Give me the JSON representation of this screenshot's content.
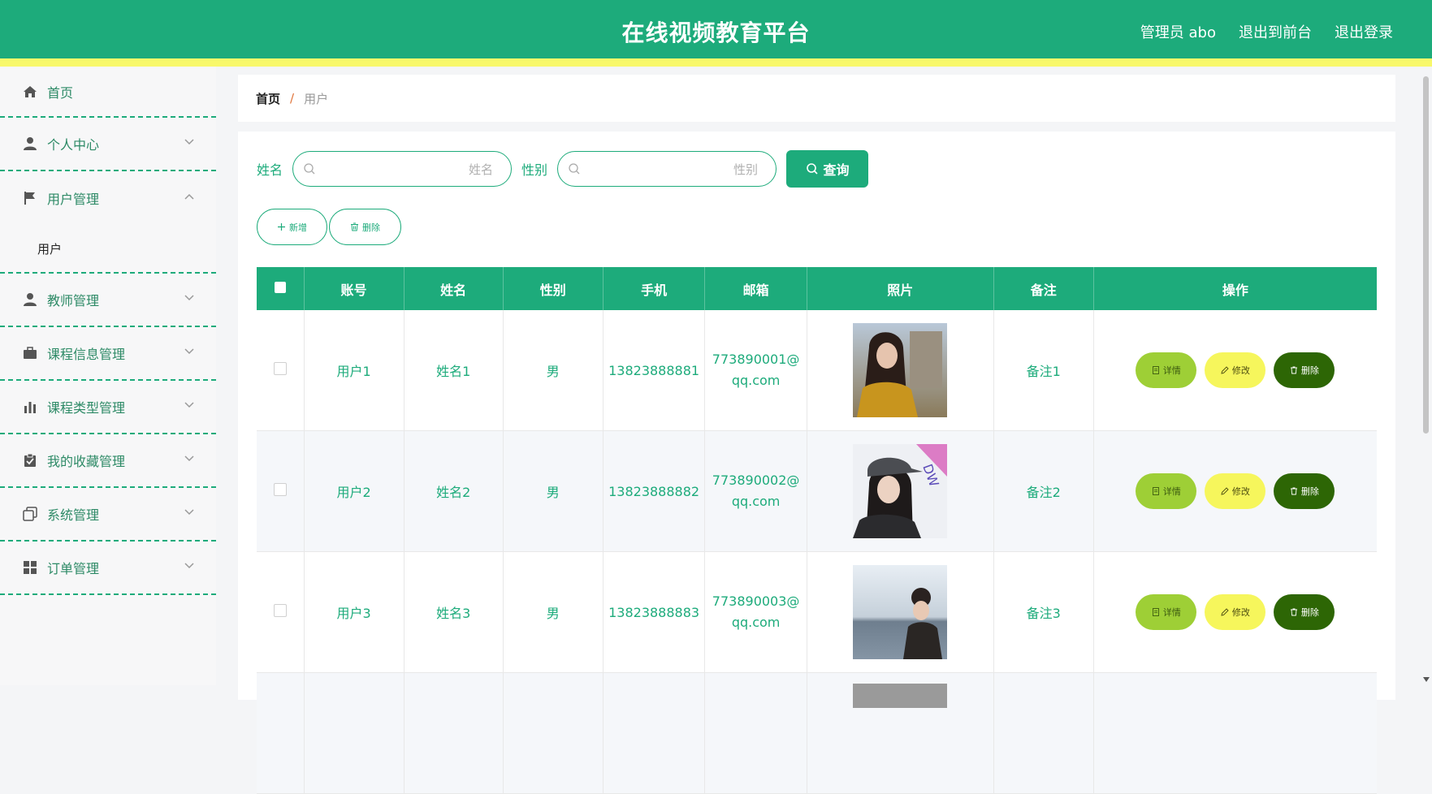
{
  "header": {
    "title": "在线视频教育平台",
    "admin_label": "管理员 abo",
    "front_label": "退出到前台",
    "logout_label": "退出登录"
  },
  "sidebar": {
    "items": [
      {
        "label": "首页",
        "icon": "home-icon"
      },
      {
        "label": "个人中心",
        "icon": "user-icon"
      },
      {
        "label": "用户管理",
        "icon": "flag-icon",
        "submenu": [
          "用户"
        ]
      },
      {
        "label": "教师管理",
        "icon": "user-icon"
      },
      {
        "label": "课程信息管理",
        "icon": "briefcase-icon"
      },
      {
        "label": "课程类型管理",
        "icon": "bar-chart-icon"
      },
      {
        "label": "我的收藏管理",
        "icon": "clipboard-icon"
      },
      {
        "label": "系统管理",
        "icon": "copy-icon"
      },
      {
        "label": "订单管理",
        "icon": "grid-icon"
      }
    ]
  },
  "breadcrumb": {
    "home": "首页",
    "separator": "/",
    "current": "用户"
  },
  "search": {
    "name_label": "姓名",
    "name_placeholder": "姓名",
    "gender_label": "性别",
    "gender_placeholder": "性别",
    "query_label": "查询"
  },
  "actions": {
    "add_label": "新增",
    "delete_label": "删除"
  },
  "table": {
    "headers": [
      "账号",
      "姓名",
      "性别",
      "手机",
      "邮箱",
      "照片",
      "备注",
      "操作"
    ],
    "rows": [
      {
        "account": "用户1",
        "name": "姓名1",
        "gender": "男",
        "phone": "13823888881",
        "email_a": "773890001@",
        "email_b": "qq.com",
        "note": "备注1"
      },
      {
        "account": "用户2",
        "name": "姓名2",
        "gender": "男",
        "phone": "13823888882",
        "email_a": "773890002@",
        "email_b": "qq.com",
        "note": "备注2"
      },
      {
        "account": "用户3",
        "name": "姓名3",
        "gender": "男",
        "phone": "13823888883",
        "email_a": "773890003@",
        "email_b": "qq.com",
        "note": "备注3"
      }
    ],
    "ops": {
      "detail": "详情",
      "edit": "修改",
      "remove": "删除"
    }
  },
  "colors": {
    "primary": "#1dab7b",
    "accent_yellow": "#f8f86a",
    "detail_btn": "#9ecf36",
    "edit_btn": "#f6f65c",
    "remove_btn": "#2d6605"
  }
}
